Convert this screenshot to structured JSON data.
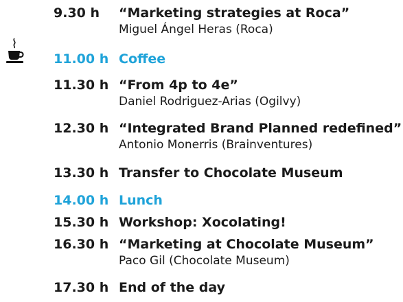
{
  "colors": {
    "text": "#1a1a1a",
    "break_accent": "#1fa3d9"
  },
  "icons": {
    "coffee": "coffee-cup-icon"
  },
  "agenda": [
    {
      "time": "9.30 h",
      "title": "“Marketing strategies at Roca”",
      "speaker": "Miguel Ángel Heras (Roca)"
    },
    {
      "time": "11.00 h",
      "title": "Coffee",
      "speaker": ""
    },
    {
      "time": "11.30 h",
      "title": "“From 4p to 4e”",
      "speaker": "Daniel Rodriguez-Arias (Ogilvy)"
    },
    {
      "time": "12.30 h",
      "title": "“Integrated Brand Planned redefined”",
      "speaker": "Antonio Monerris (Brainventures)"
    },
    {
      "time": "13.30 h",
      "title": "Transfer to Chocolate Museum",
      "speaker": ""
    },
    {
      "time": "14.00 h",
      "title": "Lunch",
      "speaker": ""
    },
    {
      "time": "15.30 h",
      "title": "Workshop: Xocolating!",
      "speaker": ""
    },
    {
      "time": "16.30 h",
      "title": "“Marketing at Chocolate Museum”",
      "speaker": "Paco Gil (Chocolate Museum)"
    },
    {
      "time": "17.30 h",
      "title": "End of the day",
      "speaker": ""
    }
  ]
}
